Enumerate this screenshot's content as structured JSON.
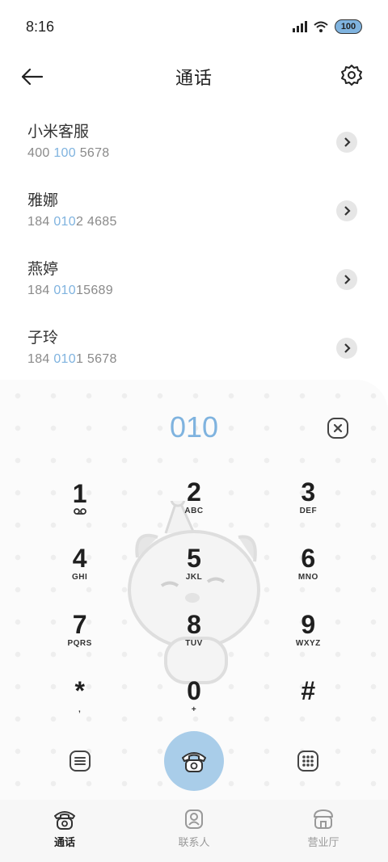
{
  "status": {
    "time": "8:16",
    "battery": "100"
  },
  "header": {
    "title": "通话"
  },
  "contacts": [
    {
      "name": "小米客服",
      "number_parts": [
        "400",
        " ",
        "100",
        " 5678"
      ]
    },
    {
      "name": "雅娜",
      "number_parts": [
        "184 ",
        "010",
        "2 4685",
        ""
      ]
    },
    {
      "name": "燕婷",
      "number_parts": [
        "184 ",
        "010",
        "15689",
        ""
      ]
    },
    {
      "name": "子玲",
      "number_parts": [
        "184 ",
        "010",
        "1 5678",
        ""
      ]
    }
  ],
  "dialer": {
    "input": "010",
    "keys": [
      {
        "digit": "1",
        "letters": ""
      },
      {
        "digit": "2",
        "letters": "ABC"
      },
      {
        "digit": "3",
        "letters": "DEF"
      },
      {
        "digit": "4",
        "letters": "GHI"
      },
      {
        "digit": "5",
        "letters": "JKL"
      },
      {
        "digit": "6",
        "letters": "MNO"
      },
      {
        "digit": "7",
        "letters": "PQRS"
      },
      {
        "digit": "8",
        "letters": "TUV"
      },
      {
        "digit": "9",
        "letters": "WXYZ"
      },
      {
        "digit": "*",
        "letters": ","
      },
      {
        "digit": "0",
        "letters": "+"
      },
      {
        "digit": "#",
        "letters": ""
      }
    ]
  },
  "nav": {
    "calls": "通话",
    "contacts": "联系人",
    "hall": "营业厅"
  },
  "colors": {
    "accent": "#7fb3df",
    "call_button": "#a9cde9"
  },
  "icons": {
    "back": "arrow-left-icon",
    "settings": "gear-icon",
    "row_action": "chevron-right-icon",
    "delete": "backspace-icon",
    "voicemail": "voicemail-icon",
    "menu": "list-icon",
    "call": "phone-icon",
    "dialpad": "dialpad-icon"
  }
}
